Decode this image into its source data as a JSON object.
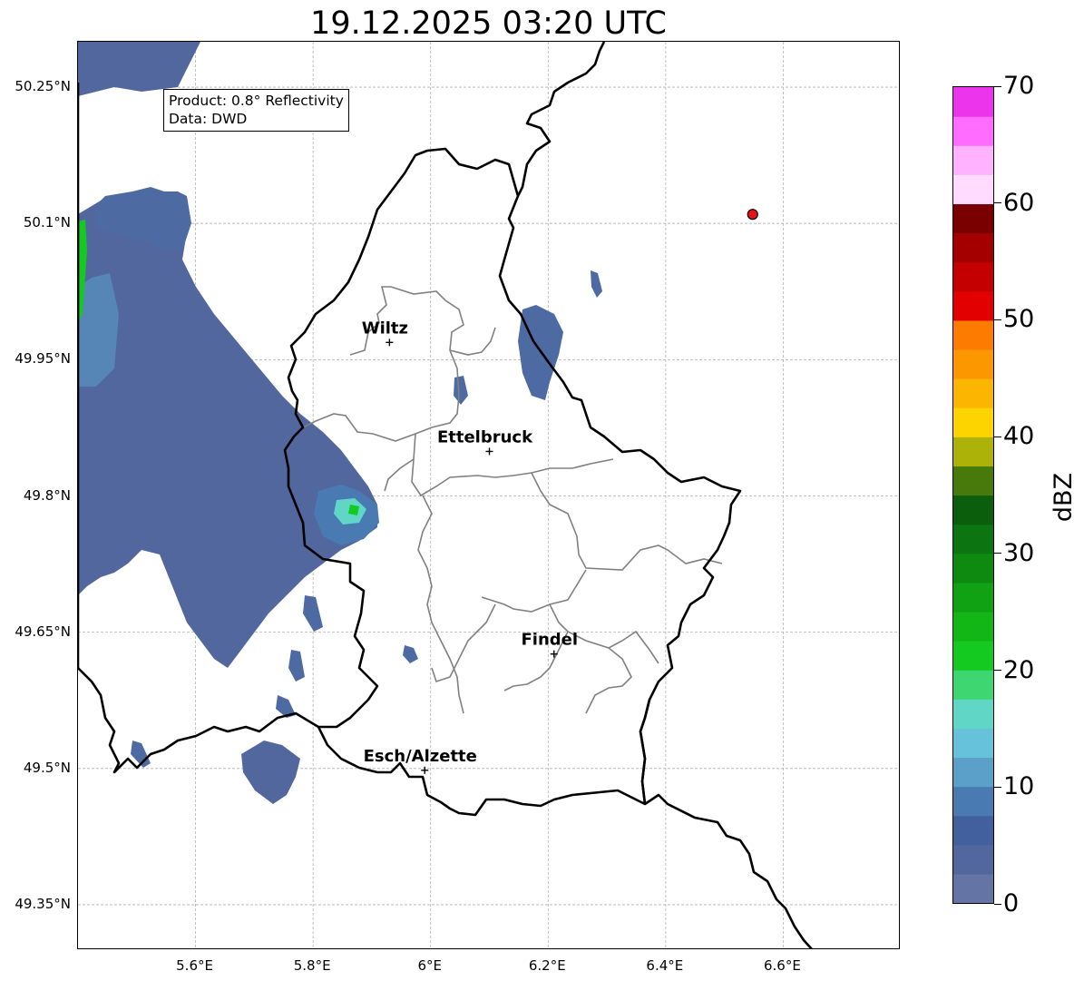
{
  "title": "19.12.2025 03:20 UTC",
  "info_box": {
    "product": "Product: 0.8° Reflectivity",
    "source": "Data: DWD"
  },
  "map": {
    "lon_range": [
      5.4,
      6.8
    ],
    "lat_range": [
      49.3,
      50.3
    ],
    "lat_ticks": [
      {
        "value": 50.25,
        "label": "50.25°N"
      },
      {
        "value": 50.1,
        "label": "50.1°N"
      },
      {
        "value": 49.95,
        "label": "49.95°N"
      },
      {
        "value": 49.8,
        "label": "49.8°N"
      },
      {
        "value": 49.65,
        "label": "49.65°N"
      },
      {
        "value": 49.5,
        "label": "49.5°N"
      },
      {
        "value": 49.35,
        "label": "49.35°N"
      }
    ],
    "lon_ticks": [
      {
        "value": 5.6,
        "label": "5.6°E"
      },
      {
        "value": 5.8,
        "label": "5.8°E"
      },
      {
        "value": 6.0,
        "label": "6°E"
      },
      {
        "value": 6.2,
        "label": "6.2°E"
      },
      {
        "value": 6.4,
        "label": "6.4°E"
      },
      {
        "value": 6.6,
        "label": "6.6°E"
      }
    ],
    "gridlines": true,
    "cities": [
      {
        "name": "Wiltz",
        "lon": 5.93,
        "lat": 49.969
      },
      {
        "name": "Ettelbruck",
        "lon": 6.1,
        "lat": 49.849
      },
      {
        "name": "Findel",
        "lon": 6.21,
        "lat": 49.626
      },
      {
        "name": "Esch/Alzette",
        "lon": 5.99,
        "lat": 49.498
      }
    ],
    "radar_site": {
      "lon": 6.548,
      "lat": 50.11,
      "color": "#e8121a"
    },
    "country_border_color": "#000000",
    "district_border_color": "#808080"
  },
  "colorbar": {
    "unit": "dBZ",
    "min": 0,
    "max": 70,
    "tick_labels": [
      {
        "value": 0,
        "label": "0"
      },
      {
        "value": 10,
        "label": "10"
      },
      {
        "value": 20,
        "label": "20"
      },
      {
        "value": 30,
        "label": "30"
      },
      {
        "value": 40,
        "label": "40"
      },
      {
        "value": 50,
        "label": "50"
      },
      {
        "value": 60,
        "label": "60"
      },
      {
        "value": 70,
        "label": "70"
      }
    ],
    "colors": [
      "#6474a4",
      "#52679d",
      "#43609e",
      "#4a7ab2",
      "#5aa0c8",
      "#66c2da",
      "#60d6c6",
      "#3ed670",
      "#14ca20",
      "#12b716",
      "#10a212",
      "#0e8a10",
      "#0c7410",
      "#0a5e0c",
      "#477a0a",
      "#adb208",
      "#fed400",
      "#fcb500",
      "#fc9700",
      "#fc7b00",
      "#e20000",
      "#c40000",
      "#a50000",
      "#7a0000",
      "#ffdcff",
      "#ffb2ff",
      "#ff6cff",
      "#ec34ec"
    ]
  }
}
